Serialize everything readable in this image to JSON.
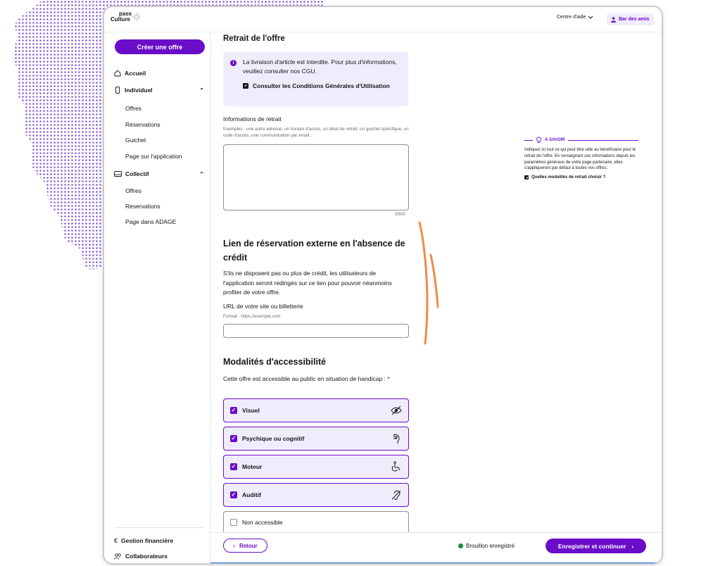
{
  "header": {
    "logo_line1": "pass",
    "logo_line2": "Culture",
    "help_label": "Centre d'aide",
    "venue_label": "Bar des amis"
  },
  "sidebar": {
    "create_label": "Créer une offre",
    "home_label": "Accueil",
    "individuel": {
      "label": "Individuel",
      "items": [
        "Offres",
        "Réservations",
        "Guichet",
        "Page sur l'application"
      ]
    },
    "collectif": {
      "label": "Collectif",
      "items": [
        "Offres",
        "Réservations",
        "Page dans ADAGE"
      ]
    },
    "finance_label": "Gestion financière",
    "collab_label": "Collaborateurs"
  },
  "main": {
    "section_retrait_title": "Retrait de l'offre",
    "info_text": "La livraison d'article est interdite. Pour plus d'informations, veuillez consulter nos CGU.",
    "info_link": "Consulter les Conditions Générales d'Utilisation",
    "retrait_label": "Informations de retrait",
    "retrait_hint": "Exemples : une autre adresse, un horaire d'accès, un délai de retrait, un guichet spécifique, un code d'accès, une communication par email...",
    "retrait_value": "",
    "retrait_counter": "0/500",
    "lien_title": "Lien de réservation externe en l'absence de crédit",
    "lien_text": "S'ils ne disposent pas ou plus de crédit, les utilisateurs de l'application seront redirigés sur ce lien pour pouvoir néanmoins profiter de votre offre.",
    "url_label": "URL de votre site ou billetterie",
    "url_hint": "Format : https://exemple.com",
    "url_value": "",
    "access_title": "Modalités d'accessibilité",
    "access_text": "Cette offre est accessible au public en situation de handicap : *",
    "access_options": [
      {
        "label": "Visuel",
        "checked": true,
        "icon": "eye-icon"
      },
      {
        "label": "Psychique ou cognitif",
        "checked": true,
        "icon": "mental-icon"
      },
      {
        "label": "Moteur",
        "checked": true,
        "icon": "wheelchair-icon"
      },
      {
        "label": "Auditif",
        "checked": true,
        "icon": "ear-icon"
      },
      {
        "label": "Non accessible",
        "checked": false,
        "icon": ""
      }
    ]
  },
  "aside": {
    "heading": "À SAVOIR",
    "body": "Indiquez ici tout ce qui peut être utile au bénéficiaire pour le retrait de l'offre. En renseignant ces informations depuis les paramètres généraux de votre page partenaire, elles s'appliqueront par défaut à toutes vos offres.",
    "link": "Quelles modalités de retrait choisir ?"
  },
  "footer": {
    "back_label": "Retour",
    "saved_label": "Brouillon enregistré",
    "save_label": "Enregistrer et continuer"
  },
  "colors": {
    "primary": "#6a0dc9",
    "primary_light": "#f1ecfb",
    "success": "#1f8a3d",
    "annotation": "#f08a4b"
  }
}
